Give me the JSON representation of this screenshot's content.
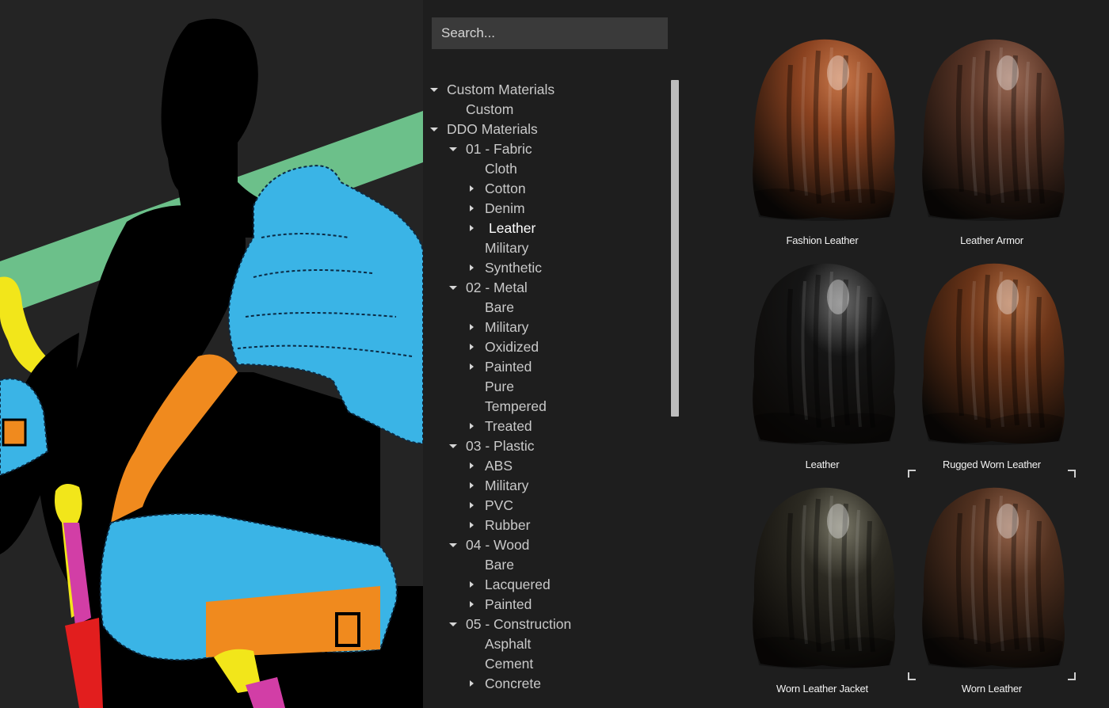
{
  "search": {
    "placeholder": "Search..."
  },
  "tree": [
    {
      "label": "Custom Materials",
      "depth": 0,
      "arrow": "down"
    },
    {
      "label": "Custom",
      "depth": 1,
      "arrow": "none"
    },
    {
      "label": "DDO Materials",
      "depth": 0,
      "arrow": "down"
    },
    {
      "label": "01 - Fabric",
      "depth": 1,
      "arrow": "down"
    },
    {
      "label": "Cloth",
      "depth": 2,
      "arrow": "none"
    },
    {
      "label": "Cotton",
      "depth": 2,
      "arrow": "right"
    },
    {
      "label": "Denim",
      "depth": 2,
      "arrow": "right"
    },
    {
      "label": "Leather",
      "depth": 2,
      "arrow": "right",
      "selected": true
    },
    {
      "label": "Military",
      "depth": 2,
      "arrow": "none"
    },
    {
      "label": "Synthetic",
      "depth": 2,
      "arrow": "right"
    },
    {
      "label": "02 - Metal",
      "depth": 1,
      "arrow": "down"
    },
    {
      "label": "Bare",
      "depth": 2,
      "arrow": "none"
    },
    {
      "label": "Military",
      "depth": 2,
      "arrow": "right"
    },
    {
      "label": "Oxidized",
      "depth": 2,
      "arrow": "right"
    },
    {
      "label": "Painted",
      "depth": 2,
      "arrow": "right"
    },
    {
      "label": "Pure",
      "depth": 2,
      "arrow": "none"
    },
    {
      "label": "Tempered",
      "depth": 2,
      "arrow": "none"
    },
    {
      "label": "Treated",
      "depth": 2,
      "arrow": "right"
    },
    {
      "label": "03 - Plastic",
      "depth": 1,
      "arrow": "down"
    },
    {
      "label": "ABS",
      "depth": 2,
      "arrow": "right"
    },
    {
      "label": "Military",
      "depth": 2,
      "arrow": "right"
    },
    {
      "label": "PVC",
      "depth": 2,
      "arrow": "right"
    },
    {
      "label": "Rubber",
      "depth": 2,
      "arrow": "right"
    },
    {
      "label": "04 - Wood",
      "depth": 1,
      "arrow": "down"
    },
    {
      "label": "Bare",
      "depth": 2,
      "arrow": "none"
    },
    {
      "label": "Lacquered",
      "depth": 2,
      "arrow": "right"
    },
    {
      "label": "Painted",
      "depth": 2,
      "arrow": "right"
    },
    {
      "label": "05 - Construction",
      "depth": 1,
      "arrow": "down"
    },
    {
      "label": "Asphalt",
      "depth": 2,
      "arrow": "none"
    },
    {
      "label": "Cement",
      "depth": 2,
      "arrow": "none"
    },
    {
      "label": "Concrete",
      "depth": 2,
      "arrow": "right"
    }
  ],
  "materials": [
    {
      "name": "Fashion Leather",
      "color": "#8a4220",
      "highlight": "#c8774a"
    },
    {
      "name": "Leather Armor",
      "color": "#5a3526",
      "highlight": "#9a6a55"
    },
    {
      "name": "Leather",
      "color": "#151515",
      "highlight": "#6a6a6a"
    },
    {
      "name": "Rugged Worn Leather",
      "color": "#6a3418",
      "highlight": "#b06a40",
      "selected": true
    },
    {
      "name": "Worn Leather Jacket",
      "color": "#2c2a22",
      "highlight": "#7a7868"
    },
    {
      "name": "Worn Leather",
      "color": "#50301f",
      "highlight": "#94634a"
    }
  ]
}
